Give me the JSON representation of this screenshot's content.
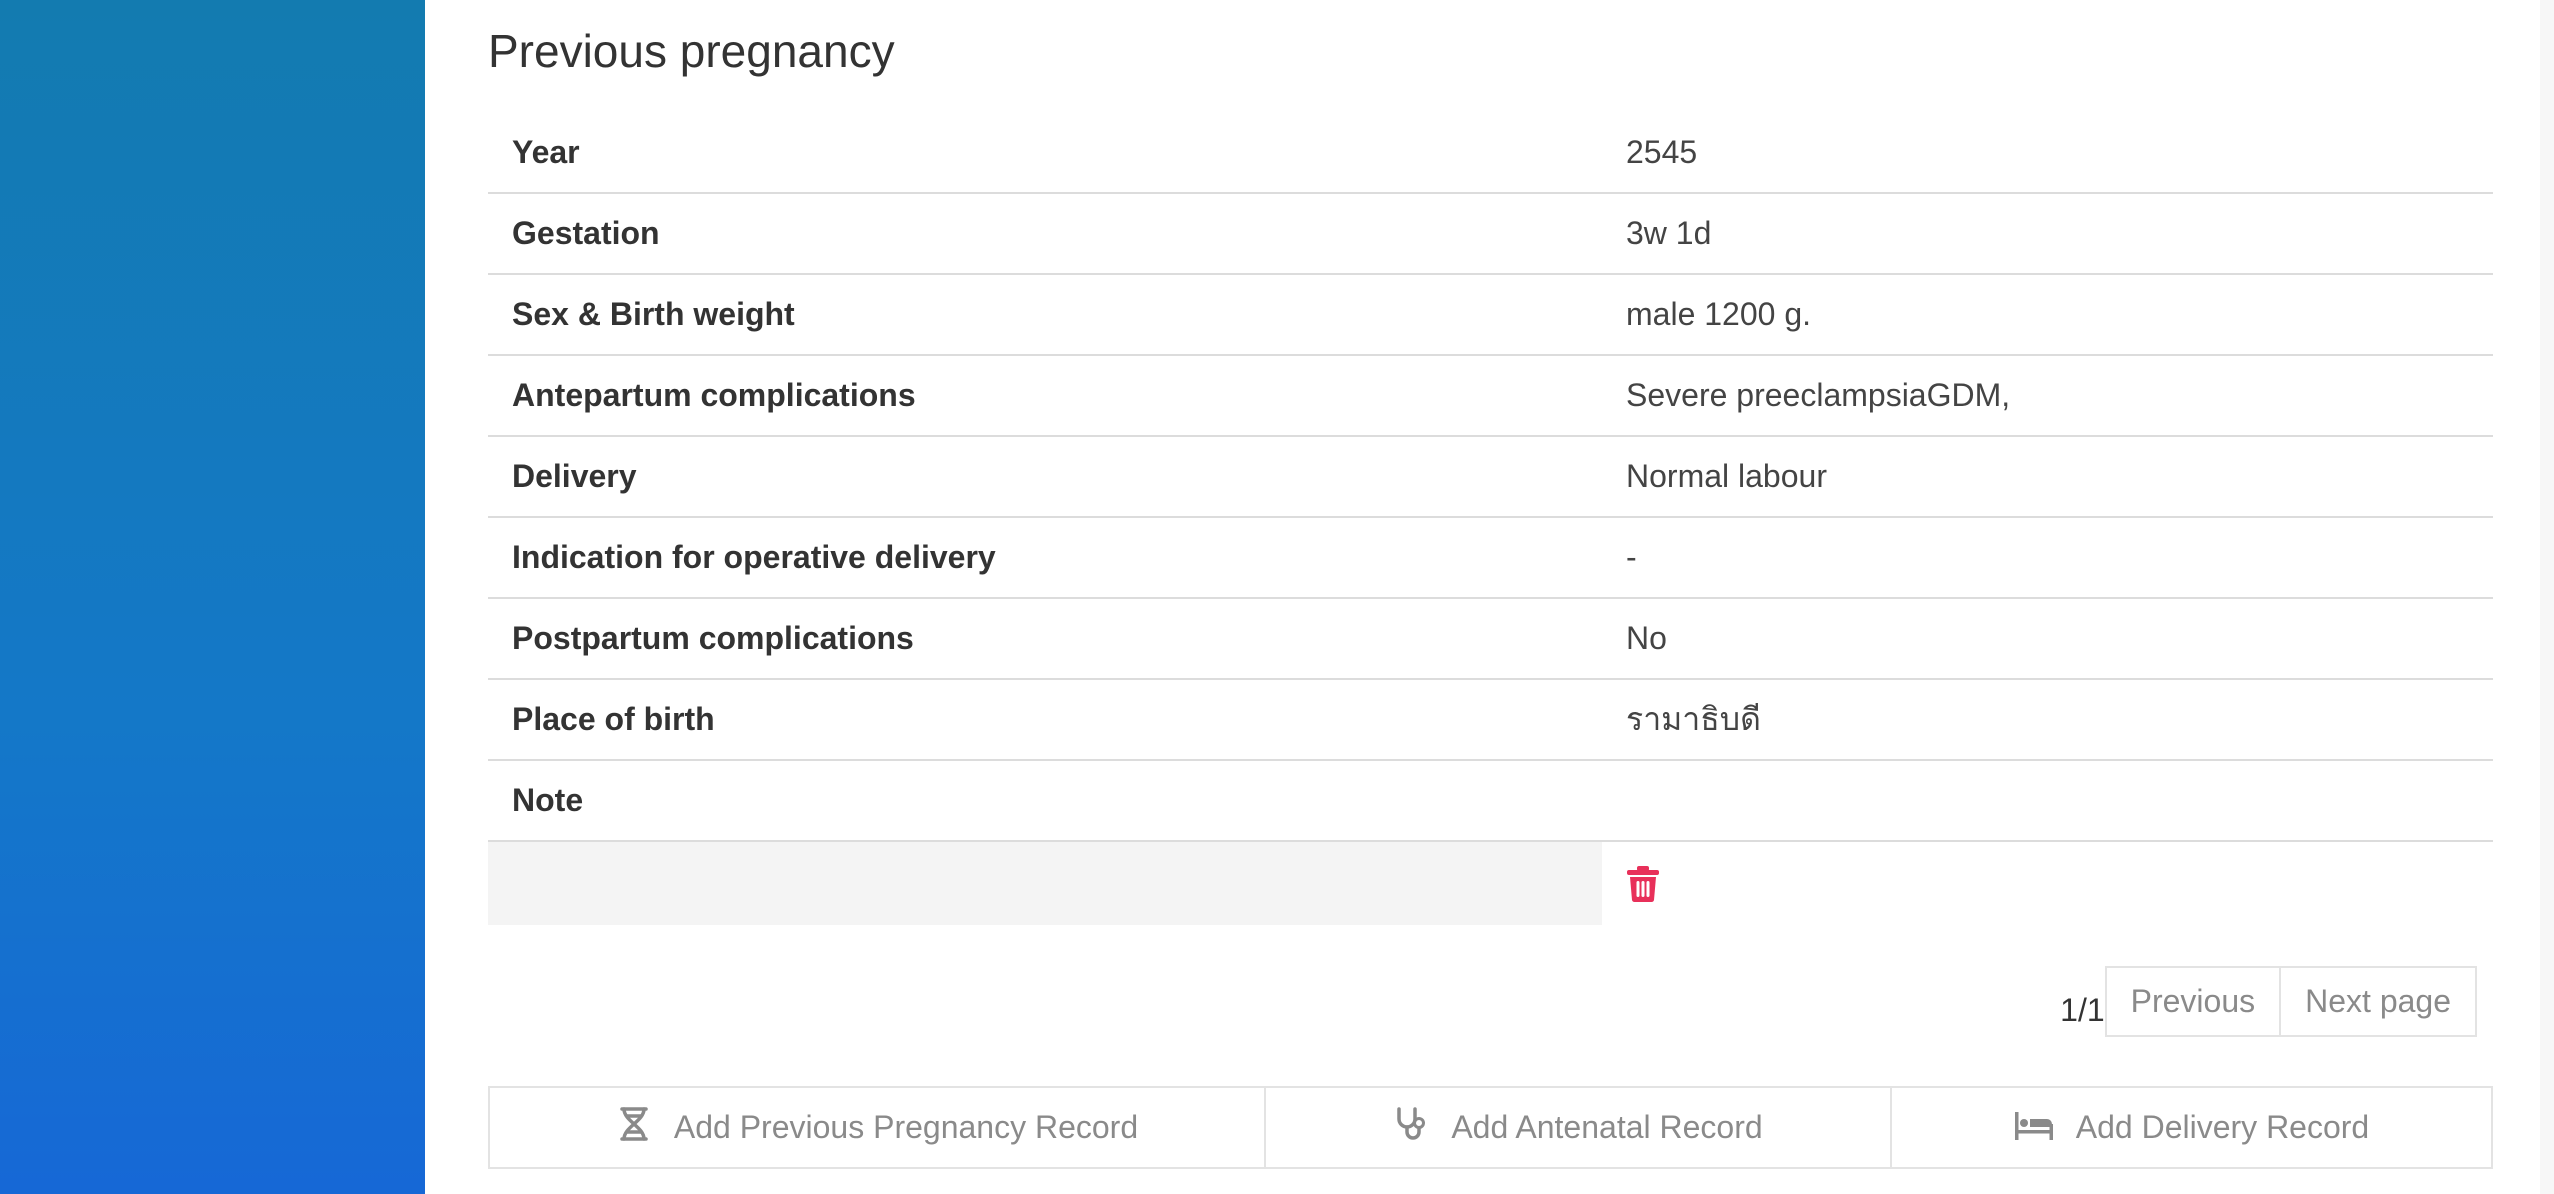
{
  "page": {
    "title": "Previous pregnancy"
  },
  "record": {
    "rows": [
      {
        "label": "Year",
        "value": "2545"
      },
      {
        "label": "Gestation",
        "value": "3w 1d"
      },
      {
        "label": "Sex & Birth weight",
        "value": "male 1200 g."
      },
      {
        "label": "Antepartum complications",
        "value": "Severe preeclampsiaGDM,"
      },
      {
        "label": "Delivery",
        "value": "Normal labour"
      },
      {
        "label": "Indication for operative delivery",
        "value": "-"
      },
      {
        "label": "Postpartum complications",
        "value": "No"
      },
      {
        "label": "Place of birth",
        "value": "รามาธิบดี"
      },
      {
        "label": "Note",
        "value": ""
      }
    ]
  },
  "pagination": {
    "count": "1/1",
    "previous": "Previous",
    "next": "Next page"
  },
  "actions": {
    "add_previous": "Add Previous Pregnancy Record",
    "add_antenatal": "Add Antenatal Record",
    "add_delivery": "Add Delivery Record"
  },
  "icons": {
    "delete": "trash-icon",
    "previous_pregnancy": "dna-icon",
    "antenatal": "stethoscope-icon",
    "delivery": "bed-icon"
  },
  "colors": {
    "sidebar_top": "#137bb0",
    "sidebar_bottom": "#1668d6",
    "delete_icon": "#e8305a",
    "muted_text": "#8a8a8a"
  }
}
